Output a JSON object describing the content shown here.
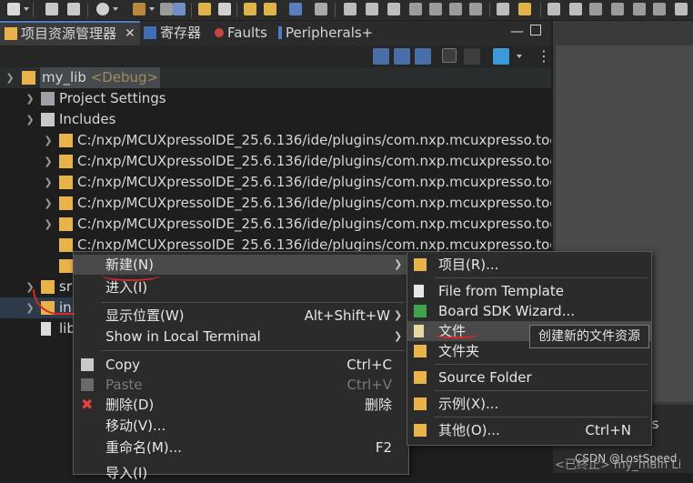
{
  "tabs": {
    "project_explorer": "项目资源管理器",
    "registers": "寄存器",
    "faults": "Faults",
    "peripherals": "Peripherals+"
  },
  "tree": {
    "project": "my_lib",
    "config": "<Debug>",
    "project_settings": "Project Settings",
    "includes": "Includes",
    "include_path": "C:/nxp/MCUXpressoIDE_25.6.136/ide/plugins/com.nxp.mcuxpresso.too",
    "partial_src": "sr",
    "partial_inc": "in",
    "partial_lib": "lib"
  },
  "context_menu": {
    "new": "新建(N)",
    "go_into": "进入(I)",
    "show_in": "显示位置(W)",
    "show_in_shortcut": "Alt+Shift+W",
    "show_in_terminal": "Show in Local Terminal",
    "copy": "Copy",
    "copy_shortcut": "Ctrl+C",
    "paste": "Paste",
    "paste_shortcut": "Ctrl+V",
    "delete": "删除(D)",
    "delete_shortcut": "删除",
    "move": "移动(V)...",
    "rename": "重命名(M)...",
    "rename_shortcut": "F2",
    "import": "导入(I)"
  },
  "submenu": {
    "project": "项目(R)...",
    "file_from_template": "File from Template",
    "board_sdk_wizard": "Board SDK Wizard...",
    "file": "文件",
    "folder": "文件夹",
    "source_folder": "Source Folder",
    "example": "示例(X)...",
    "other": "其他(O)...",
    "other_shortcut": "Ctrl+N"
  },
  "tooltip": "创建新的文件资源",
  "right_panel": {
    "tab_fragment": "ks",
    "bottom_text": "<已终止> my_main Li",
    "watermark": "CSDN @LostSpeed"
  },
  "colors": {
    "accent": "#4c7bc8",
    "annotation": "#d42a2a",
    "folder": "#e8b34a"
  }
}
